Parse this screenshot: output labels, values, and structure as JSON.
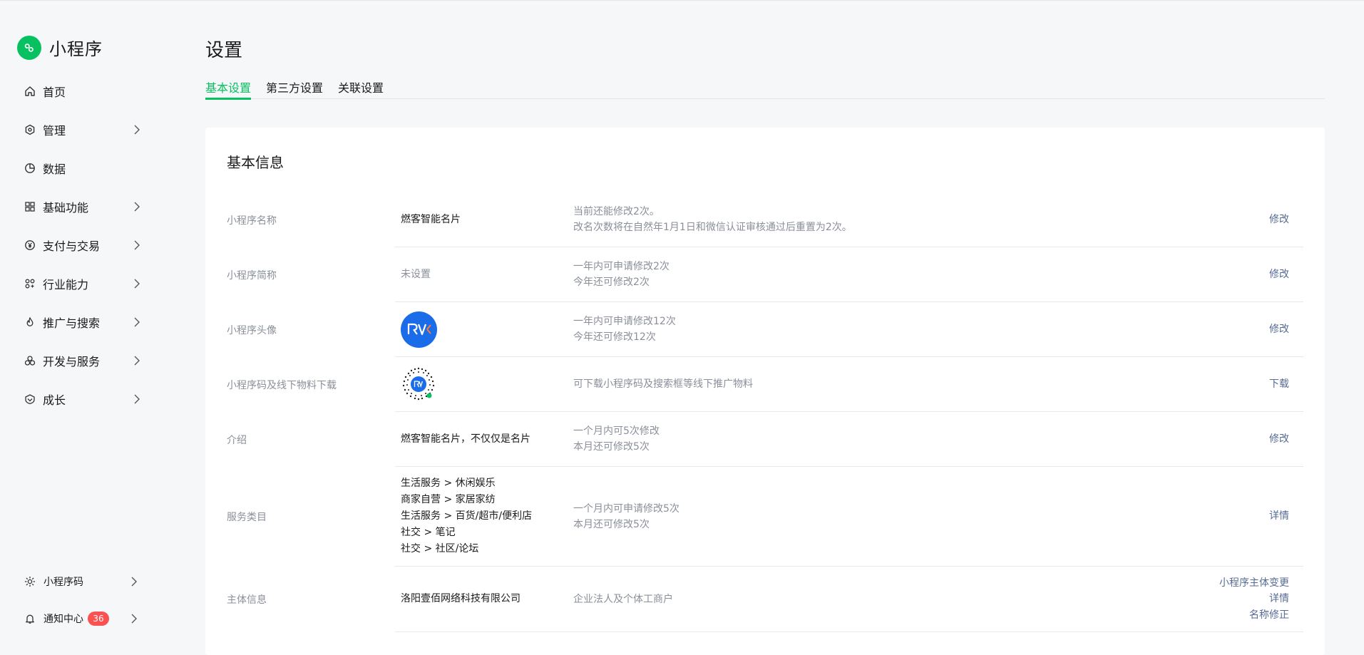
{
  "app": {
    "brand_name": "小程序",
    "brand_color": "#07c160"
  },
  "sidebar": {
    "items": [
      {
        "label": "首页",
        "icon": "home-icon",
        "has_chevron": false
      },
      {
        "label": "管理",
        "icon": "manage-icon",
        "has_chevron": true
      },
      {
        "label": "数据",
        "icon": "data-pie-icon",
        "has_chevron": false
      },
      {
        "label": "基础功能",
        "icon": "grid-icon",
        "has_chevron": true
      },
      {
        "label": "支付与交易",
        "icon": "yen-coin-icon",
        "has_chevron": true
      },
      {
        "label": "行业能力",
        "icon": "industry-icon",
        "has_chevron": true
      },
      {
        "label": "推广与搜索",
        "icon": "flame-icon",
        "has_chevron": true
      },
      {
        "label": "开发与服务",
        "icon": "dev-service-icon",
        "has_chevron": true
      },
      {
        "label": "成长",
        "icon": "growth-icon",
        "has_chevron": true
      }
    ],
    "bottom": [
      {
        "label": "小程序码",
        "icon": "sun-icon"
      },
      {
        "label": "通知中心",
        "icon": "bell-icon",
        "badge": "36"
      }
    ]
  },
  "page": {
    "title": "设置",
    "tabs": [
      {
        "label": "基本设置",
        "active": true
      },
      {
        "label": "第三方设置",
        "active": false
      },
      {
        "label": "关联设置",
        "active": false
      }
    ]
  },
  "basic_info": {
    "title": "基本信息",
    "rows": [
      {
        "label": "小程序名称",
        "value": "燃客智能名片",
        "desc": [
          "当前还能修改2次。",
          "改名次数将在自然年1月1日和微信认证审核通过后重置为2次。"
        ],
        "actions": [
          "修改"
        ]
      },
      {
        "label": "小程序简称",
        "value": "未设置",
        "desc": [
          "一年内可申请修改2次",
          "今年还可修改2次"
        ],
        "actions": [
          "修改"
        ]
      },
      {
        "label": "小程序头像",
        "value_image": "avatar-logo",
        "desc": [
          "一年内可申请修改12次",
          "今年还可修改12次"
        ],
        "actions": [
          "修改"
        ]
      },
      {
        "label": "小程序码及线下物料下载",
        "value_image": "mini-program-code",
        "desc": [
          "可下载小程序码及搜索框等线下推广物料"
        ],
        "actions": [
          "下载"
        ]
      },
      {
        "label": "介绍",
        "value": "燃客智能名片，不仅仅是名片",
        "desc": [
          "一个月内可5次修改",
          "本月还可修改5次"
        ],
        "actions": [
          "修改"
        ]
      },
      {
        "label": "服务类目",
        "value_lines": [
          "生活服务 > 休闲娱乐",
          "商家自营 > 家居家纺",
          "生活服务 > 百货/超市/便利店",
          "社交 > 笔记",
          "社交 > 社区/论坛"
        ],
        "desc": [
          "一个月内可申请修改5次",
          "本月还可修改5次"
        ],
        "actions": [
          "详情"
        ]
      },
      {
        "label": "主体信息",
        "value": "洛阳壹佰网络科技有限公司",
        "desc": [
          "企业法人及个体工商户"
        ],
        "actions": [
          "小程序主体变更",
          "详情",
          "名称修正"
        ]
      }
    ]
  },
  "colors": {
    "accent": "#07c160",
    "link": "#576b95",
    "badge": "#fa5151",
    "avatar_bg": "#1a6ce8"
  }
}
